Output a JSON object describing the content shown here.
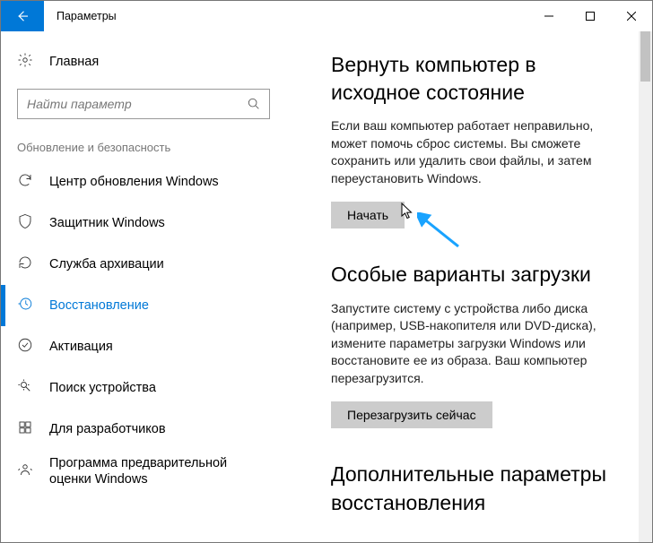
{
  "window": {
    "title": "Параметры"
  },
  "sidebar": {
    "home": "Главная",
    "search_placeholder": "Найти параметр",
    "category": "Обновление и безопасность",
    "items": [
      {
        "label": "Центр обновления Windows",
        "icon": "sync"
      },
      {
        "label": "Защитник Windows",
        "icon": "shield"
      },
      {
        "label": "Служба архивации",
        "icon": "backup"
      },
      {
        "label": "Восстановление",
        "icon": "history",
        "selected": true
      },
      {
        "label": "Активация",
        "icon": "check-circle"
      },
      {
        "label": "Поиск устройства",
        "icon": "location"
      },
      {
        "label": "Для разработчиков",
        "icon": "dev"
      },
      {
        "label": "Программа предварительной оценки Windows",
        "icon": "insider"
      }
    ]
  },
  "main": {
    "sections": [
      {
        "heading": "Вернуть компьютер в исходное состояние",
        "desc": "Если ваш компьютер работает неправильно, может помочь сброс системы. Вы сможете сохранить или удалить свои файлы, и затем переустановить Windows.",
        "button": "Начать"
      },
      {
        "heading": "Особые варианты загрузки",
        "desc": "Запустите систему с устройства либо диска (например, USB-накопителя или DVD-диска), измените параметры загрузки Windows или восстановите ее из образа. Ваш компьютер перезагрузится.",
        "button": "Перезагрузить сейчас"
      },
      {
        "heading": "Дополнительные параметры восстановления"
      }
    ]
  }
}
